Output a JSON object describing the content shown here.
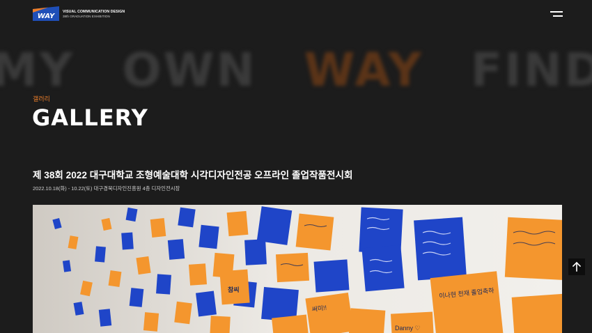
{
  "header": {
    "logo_text": "WAY",
    "brand_line1": "VISUAL COMMUNICATION DESIGN",
    "brand_line2": "38th GRADUATION EXHIBITION",
    "menu_icon": "hamburger-menu-icon"
  },
  "marquee": {
    "words": [
      "MY",
      "OWN",
      "WAY",
      "FIND"
    ]
  },
  "page": {
    "eyebrow": "갤러리",
    "title": "GALLERY"
  },
  "post": {
    "title": "제 38회 2022 대구대학교 조형예술대학 시각디자인전공 오프라인 졸업작품전시회",
    "meta": "2022.10.18(화) - 10.22(토) 대구경북디자인진흥원 4층 디자인전시장"
  },
  "hero": {
    "notes": [
      "참씨",
      "써미!!",
      "이나현 천재 졸업축하",
      "Danny ♡"
    ]
  },
  "colors": {
    "background": "#1c1c1c",
    "accent": "#ec7e2a",
    "logo_blue": "#1f4fb8",
    "note_orange": "#f4962e",
    "note_blue": "#1f45c8"
  },
  "scroll_top": {
    "icon": "arrow-up-icon"
  }
}
